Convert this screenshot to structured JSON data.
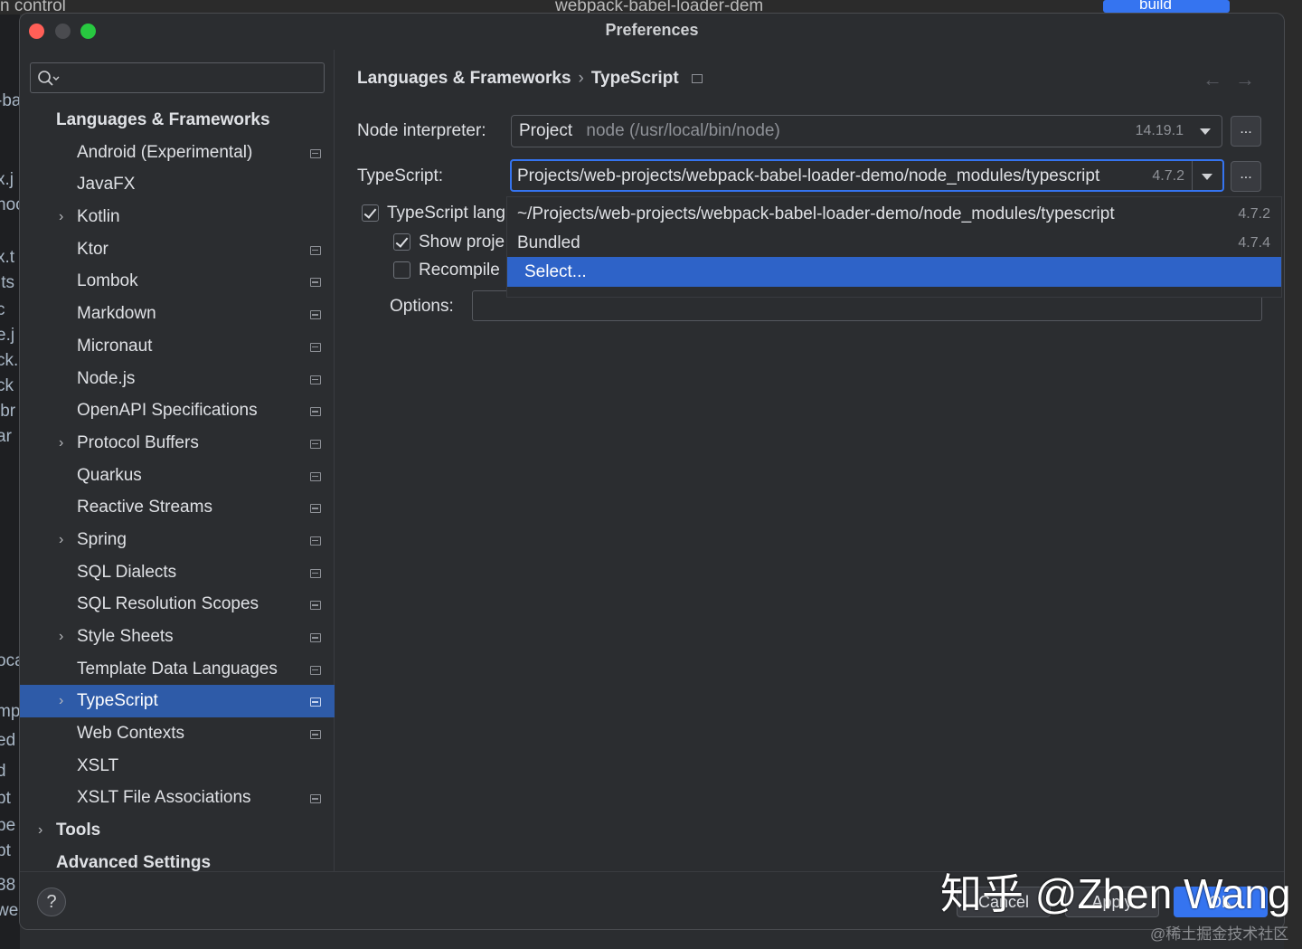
{
  "background": {
    "top_left_text": "n control",
    "top_center_text": "webpack-babel-loader-dem",
    "run_button_label": "build",
    "left_gutter_texts": [
      "-ba",
      "x.j",
      "noc",
      "x.t",
      ".ts",
      "c",
      "e.j",
      "ck.",
      "ck",
      "ibr",
      "ar",
      "oca",
      "mp",
      "ed",
      "d",
      "pt",
      "pe",
      "pt",
      "38",
      "we"
    ]
  },
  "dialog": {
    "title": "Preferences",
    "search": {
      "placeholder": "",
      "value": ""
    },
    "tree": [
      {
        "label": "Languages & Frameworks",
        "level": 0,
        "bold": true,
        "expandable": false,
        "project_icon": false,
        "selected": false
      },
      {
        "label": "Android (Experimental)",
        "level": 1,
        "bold": false,
        "expandable": false,
        "project_icon": true,
        "selected": false
      },
      {
        "label": "JavaFX",
        "level": 1,
        "bold": false,
        "expandable": false,
        "project_icon": false,
        "selected": false
      },
      {
        "label": "Kotlin",
        "level": 1,
        "bold": false,
        "expandable": true,
        "project_icon": false,
        "selected": false
      },
      {
        "label": "Ktor",
        "level": 1,
        "bold": false,
        "expandable": false,
        "project_icon": true,
        "selected": false
      },
      {
        "label": "Lombok",
        "level": 1,
        "bold": false,
        "expandable": false,
        "project_icon": true,
        "selected": false
      },
      {
        "label": "Markdown",
        "level": 1,
        "bold": false,
        "expandable": false,
        "project_icon": true,
        "selected": false
      },
      {
        "label": "Micronaut",
        "level": 1,
        "bold": false,
        "expandable": false,
        "project_icon": true,
        "selected": false
      },
      {
        "label": "Node.js",
        "level": 1,
        "bold": false,
        "expandable": false,
        "project_icon": true,
        "selected": false
      },
      {
        "label": "OpenAPI Specifications",
        "level": 1,
        "bold": false,
        "expandable": false,
        "project_icon": true,
        "selected": false
      },
      {
        "label": "Protocol Buffers",
        "level": 1,
        "bold": false,
        "expandable": true,
        "project_icon": true,
        "selected": false
      },
      {
        "label": "Quarkus",
        "level": 1,
        "bold": false,
        "expandable": false,
        "project_icon": true,
        "selected": false
      },
      {
        "label": "Reactive Streams",
        "level": 1,
        "bold": false,
        "expandable": false,
        "project_icon": true,
        "selected": false
      },
      {
        "label": "Spring",
        "level": 1,
        "bold": false,
        "expandable": true,
        "project_icon": true,
        "selected": false
      },
      {
        "label": "SQL Dialects",
        "level": 1,
        "bold": false,
        "expandable": false,
        "project_icon": true,
        "selected": false
      },
      {
        "label": "SQL Resolution Scopes",
        "level": 1,
        "bold": false,
        "expandable": false,
        "project_icon": true,
        "selected": false
      },
      {
        "label": "Style Sheets",
        "level": 1,
        "bold": false,
        "expandable": true,
        "project_icon": true,
        "selected": false
      },
      {
        "label": "Template Data Languages",
        "level": 1,
        "bold": false,
        "expandable": false,
        "project_icon": true,
        "selected": false
      },
      {
        "label": "TypeScript",
        "level": 1,
        "bold": false,
        "expandable": true,
        "project_icon": true,
        "selected": true
      },
      {
        "label": "Web Contexts",
        "level": 1,
        "bold": false,
        "expandable": false,
        "project_icon": true,
        "selected": false
      },
      {
        "label": "XSLT",
        "level": 1,
        "bold": false,
        "expandable": false,
        "project_icon": false,
        "selected": false
      },
      {
        "label": "XSLT File Associations",
        "level": 1,
        "bold": false,
        "expandable": false,
        "project_icon": true,
        "selected": false
      },
      {
        "label": "Tools",
        "level": 0,
        "bold": true,
        "expandable": true,
        "project_icon": false,
        "selected": false
      },
      {
        "label": "Advanced Settings",
        "level": 0,
        "bold": true,
        "expandable": false,
        "project_icon": false,
        "selected": false
      }
    ],
    "breadcrumb": {
      "parent": "Languages & Frameworks",
      "separator": "›",
      "current": "TypeScript",
      "back": "←",
      "forward": "→"
    },
    "node_interpreter": {
      "label": "Node interpreter:",
      "prefix": "Project",
      "value": "node (/usr/local/bin/node)",
      "version": "14.19.1",
      "browse_label": "..."
    },
    "typescript": {
      "label": "TypeScript:",
      "value": "Projects/web-projects/webpack-babel-loader-demo/node_modules/typescript",
      "version": "4.7.2",
      "browse_label": "..."
    },
    "checkboxes": [
      {
        "label": "TypeScript lang",
        "checked": true
      },
      {
        "label": "Show proje",
        "checked": true
      },
      {
        "label": "Recompile",
        "checked": false
      }
    ],
    "options": {
      "label": "Options:",
      "value": ""
    },
    "dropdown": [
      {
        "label": "~/Projects/web-projects/webpack-babel-loader-demo/node_modules/typescript",
        "version": "4.7.2",
        "selected": false
      },
      {
        "label": "Bundled",
        "version": "4.7.4",
        "selected": false
      },
      {
        "label": "Select...",
        "version": "",
        "selected": true
      }
    ],
    "footer": {
      "help_label": "?",
      "cancel_label": "Cancel",
      "apply_label": "Apply",
      "ok_label": "OK"
    }
  },
  "watermark": {
    "main": "知乎 @Zhen Wang",
    "sub": "@稀土掘金技术社区"
  },
  "colors": {
    "selection": "#2e5ba8",
    "accent": "#3574f0",
    "close": "#ff5f57",
    "zoom": "#28c840"
  }
}
